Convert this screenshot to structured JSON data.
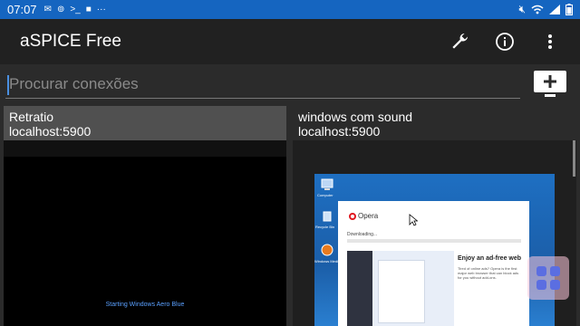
{
  "status_bar": {
    "time": "07:07",
    "left_icons": [
      "sms-icon",
      "voicemail-icon",
      "terminal-icon",
      "video-icon",
      "more-icon"
    ],
    "right_icons": [
      "mute-icon",
      "wifi-icon",
      "signal-icon",
      "battery-icon"
    ],
    "color": "#1565c0"
  },
  "app_bar": {
    "title": "aSPICE Free",
    "actions": [
      "wrench-icon",
      "info-icon",
      "overflow-menu-icon"
    ]
  },
  "search": {
    "placeholder": "Procurar conexões",
    "value": ""
  },
  "connections": [
    {
      "name": "Retratio",
      "address": "localhost:5900",
      "preview_caption": "Starting Windows Aero Blue"
    },
    {
      "name": "windows com sound",
      "address": "localhost:5900",
      "preview": {
        "desktop_icons": [
          "Computer",
          "Recycle Bin",
          "Windows Media"
        ],
        "browser_name": "Opera",
        "status_text": "Downloading...",
        "ad_title": "Enjoy an ad-free web",
        "ad_body": "Tired of online ads? Opera is the first major web browser that can block ads for you without add-ons."
      }
    }
  ],
  "accent_color": "#4a90e2",
  "fab_icon": "apps-grid-icon"
}
